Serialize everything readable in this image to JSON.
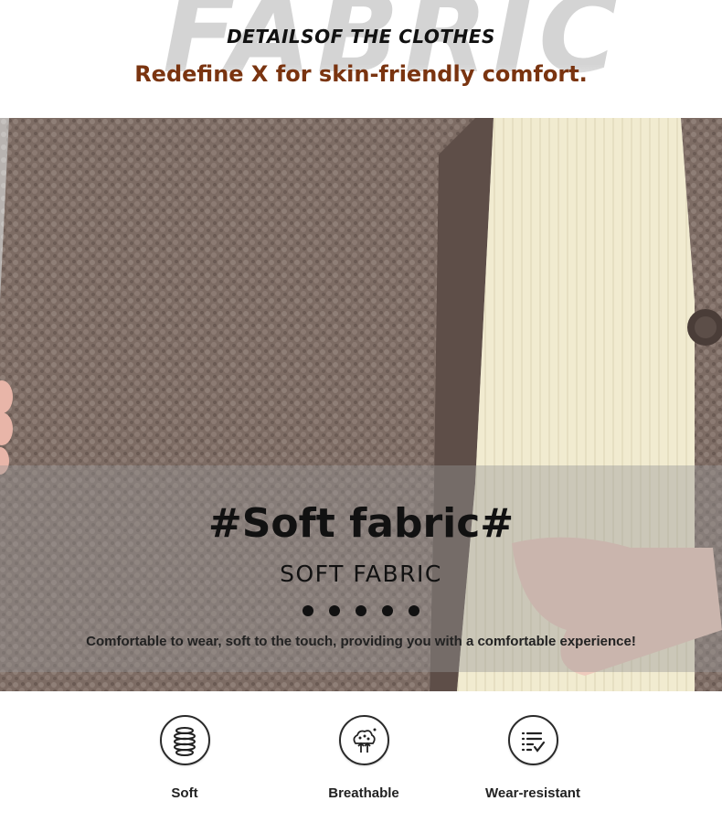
{
  "header": {
    "bg_word": "FABRIC",
    "title": "DETAILSOF THE CLOTHES",
    "subtitle": "Redefine X for skin-friendly comfort."
  },
  "banner": {
    "heading": "#Soft fabric#",
    "subheading": "SOFT FABRIC",
    "description": "Comfortable to wear, soft to the touch, providing you with a comfortable experience!",
    "dots": 5
  },
  "features": [
    {
      "label": "Soft",
      "icon": "spring-coil-icon"
    },
    {
      "label": "Breathable",
      "icon": "breathable-dots-icon"
    },
    {
      "label": "Wear-resistant",
      "icon": "checklist-icon"
    }
  ],
  "colors": {
    "subtitle": "#7a3410",
    "fleece": "#7d6c64",
    "sweater": "#f1ebd0"
  }
}
